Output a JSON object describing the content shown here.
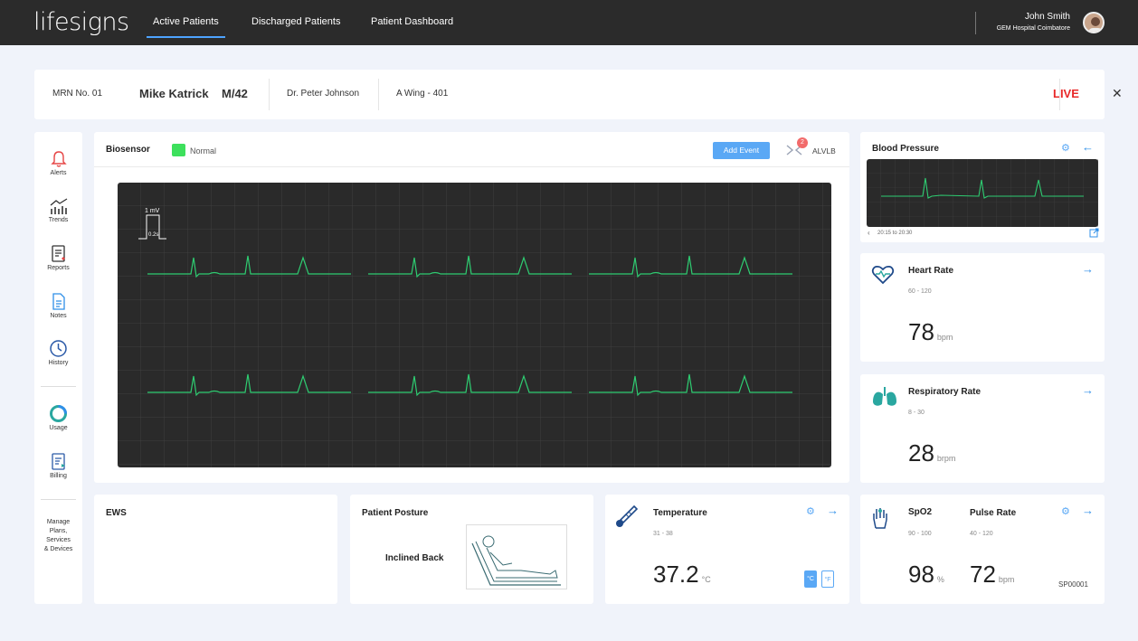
{
  "app": {
    "logo": "lifesigns"
  },
  "nav": {
    "items": [
      {
        "label": "Active Patients"
      },
      {
        "label": "Discharged Patients"
      },
      {
        "label": "Patient Dashboard"
      }
    ]
  },
  "user": {
    "name": "John Smith",
    "hospital": "GEM Hospital Coimbatore"
  },
  "patient": {
    "mrn": "MRN No. 01",
    "name": "Mike Katrick",
    "age_sex": "M/42",
    "doctor": "Dr. Peter Johnson",
    "ward": "A Wing - 401",
    "status": "LIVE"
  },
  "sidebar": {
    "items": [
      {
        "label": "Alerts",
        "icon": "bell-icon"
      },
      {
        "label": "Trends",
        "icon": "trends-icon"
      },
      {
        "label": "Reports",
        "icon": "reports-icon"
      },
      {
        "label": "Notes",
        "icon": "notes-icon"
      },
      {
        "label": "History",
        "icon": "clock-icon"
      },
      {
        "label": "Usage",
        "icon": "donut-icon"
      },
      {
        "label": "Billing",
        "icon": "billing-icon"
      }
    ],
    "manage_lines": [
      "Manage",
      "Plans,",
      "Services",
      "& Devices"
    ]
  },
  "biosensor": {
    "title": "Biosensor",
    "status": "Normal",
    "status_color": "#3de05c",
    "add_event": "Add Event",
    "badge_count": "2",
    "lead": "ALVLB",
    "calib_mv": "1 mV",
    "calib_s": "0.2s"
  },
  "blood_pressure": {
    "title": "Blood Pressure",
    "time_range": "20:15 to 20:30"
  },
  "heart_rate": {
    "title": "Heart Rate",
    "range": "60 - 120",
    "value": "78",
    "unit": "bpm"
  },
  "respiratory_rate": {
    "title": "Respiratory Rate",
    "range": "8 - 30",
    "value": "28",
    "unit": "brpm"
  },
  "ews": {
    "title": "EWS"
  },
  "posture": {
    "title": "Patient Posture",
    "value": "Inclined Back"
  },
  "temperature": {
    "title": "Temperature",
    "range": "31 - 38",
    "value": "37.2",
    "unit": "°C",
    "unit_c": "°C",
    "unit_f": "°F"
  },
  "spo2": {
    "title": "SpO2",
    "range": "90 - 100",
    "value": "98",
    "unit": "%"
  },
  "pulse": {
    "title": "Pulse Rate",
    "range": "40 - 120",
    "value": "72",
    "unit": "bpm",
    "device": "SP00001"
  },
  "colors": {
    "accent": "#2f8fe8",
    "live": "#e82929",
    "trace": "#2ecc71",
    "icon_teal": "#2aa7a0"
  }
}
